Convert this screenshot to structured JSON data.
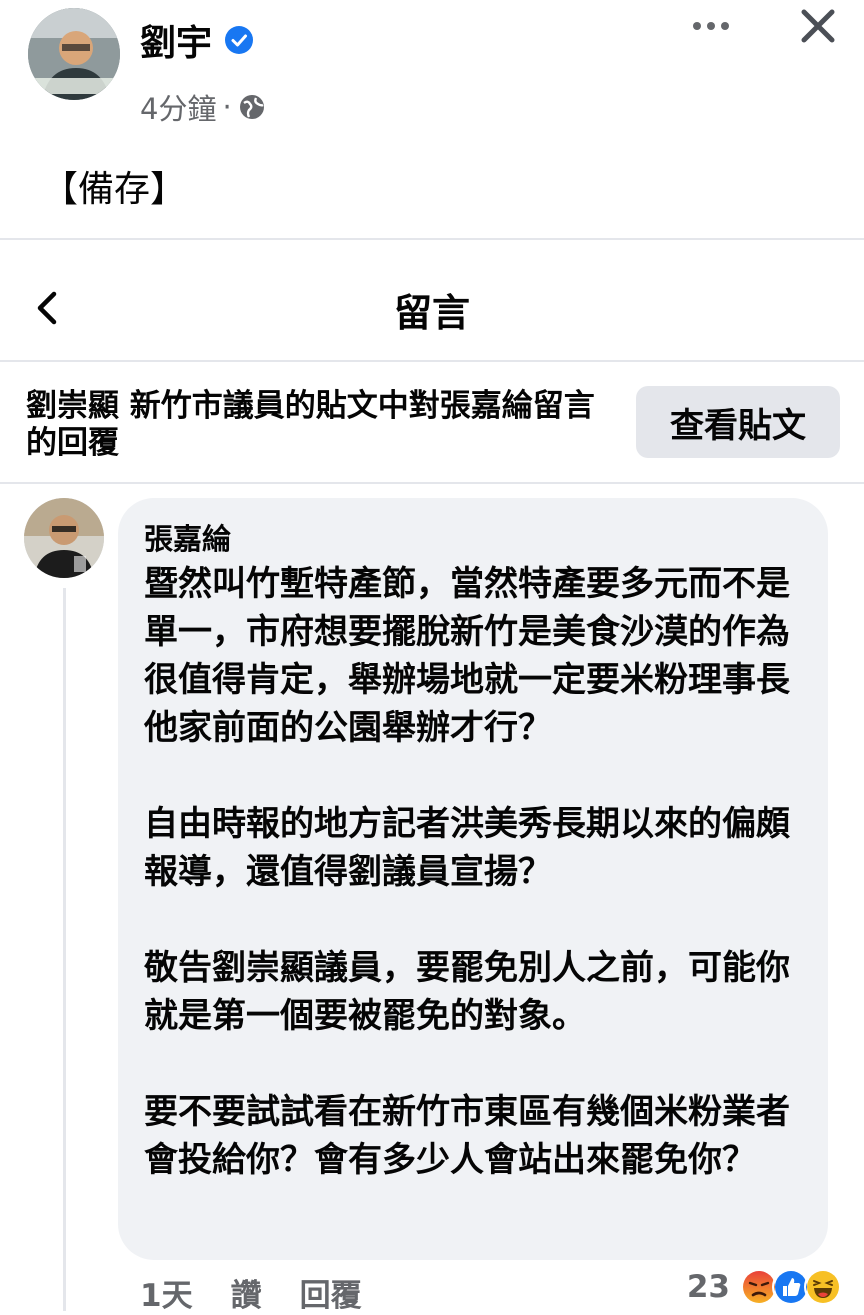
{
  "header": {
    "author_name": "劉宇",
    "timestamp": "4分鐘",
    "separator": "·",
    "visibility_icon": "globe-icon"
  },
  "post": {
    "text": "【備存】"
  },
  "comments_bar": {
    "title": "留言"
  },
  "context": {
    "description": "劉崇顯 新竹市議員的貼文中對張嘉綸留言的回覆",
    "view_post_label": "查看貼文"
  },
  "comment": {
    "author": "張嘉綸",
    "paragraphs": [
      "暨然叫竹塹特產節，當然特產要多元而不是單一，市府想要擺脫新竹是美食沙漠的作為很值得肯定，舉辦場地就一定要米粉理事長他家前面的公園舉辦才行？",
      "自由時報的地方記者洪美秀長期以來的偏頗報導，還值得劉議員宣揚？",
      "敬告劉崇顯議員，要罷免別人之前，可能你就是第一個要被罷免的對象。",
      "要不要試試看在新竹市東區有幾個米粉業者會投給你？會有多少人會站出來罷免你？"
    ],
    "age": "1天",
    "like_label": "讚",
    "reply_label": "回覆",
    "reaction_count": "23",
    "reactions": [
      "angry-icon",
      "like-icon",
      "haha-icon"
    ]
  },
  "colors": {
    "verified": "#1877f2",
    "bubble": "#f0f2f5",
    "secondary_text": "#65676b",
    "button_bg": "#e4e6eb"
  }
}
